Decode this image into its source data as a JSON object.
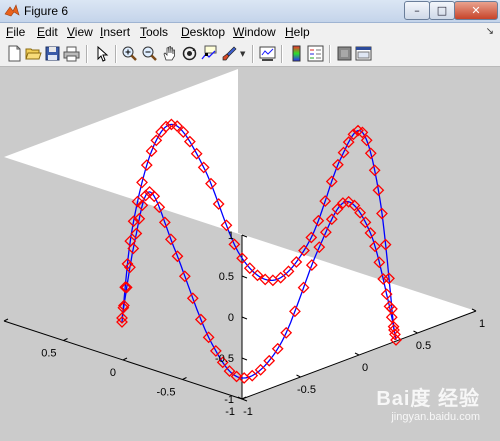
{
  "window": {
    "title": "Figure 6"
  },
  "window_controls": {
    "minimize": "–",
    "maximize": "□",
    "close": "✕"
  },
  "menu": [
    "File",
    "Edit",
    "View",
    "Insert",
    "Tools",
    "Desktop",
    "Window",
    "Help"
  ],
  "toolbar": {
    "icons": [
      "new-file-icon",
      "open-folder-icon",
      "save-icon",
      "print-icon",
      "pointer-icon",
      "zoom-in-icon",
      "zoom-out-icon",
      "pan-icon",
      "rotate-3d-icon",
      "data-cursor-icon",
      "brush-icon",
      "link-plot-icon",
      "colorbar-icon",
      "legend-icon",
      "hide-plot-tools-icon",
      "show-plot-tools-icon"
    ]
  },
  "axes": {
    "z_ticks": [
      "1",
      "0.5",
      "0",
      "-0.5",
      "-1"
    ],
    "y_ticks": [
      "1",
      "0.5",
      "0",
      "-0.5",
      "-1"
    ],
    "x_ticks": [
      "-1",
      "-0.5",
      "0",
      "0.5",
      "1"
    ]
  },
  "chart_data": {
    "type": "line",
    "view": "3d",
    "series": [
      {
        "curve": "z = sin(2πt) (front curve)",
        "line_color": "#0000ff",
        "marker": "diamond",
        "marker_color": "#ff0000"
      },
      {
        "curve": "z = sin(2πt) (back curve)",
        "line_color": "#0000ff",
        "marker": "diamond",
        "marker_color": "#ff0000"
      }
    ],
    "xlim": [
      -1,
      1
    ],
    "ylim": [
      -1,
      1
    ],
    "zlim": [
      -1,
      1
    ],
    "grid": false
  },
  "watermark": {
    "brand": "Bai度 经验",
    "url": "jingyan.baidu.com"
  }
}
